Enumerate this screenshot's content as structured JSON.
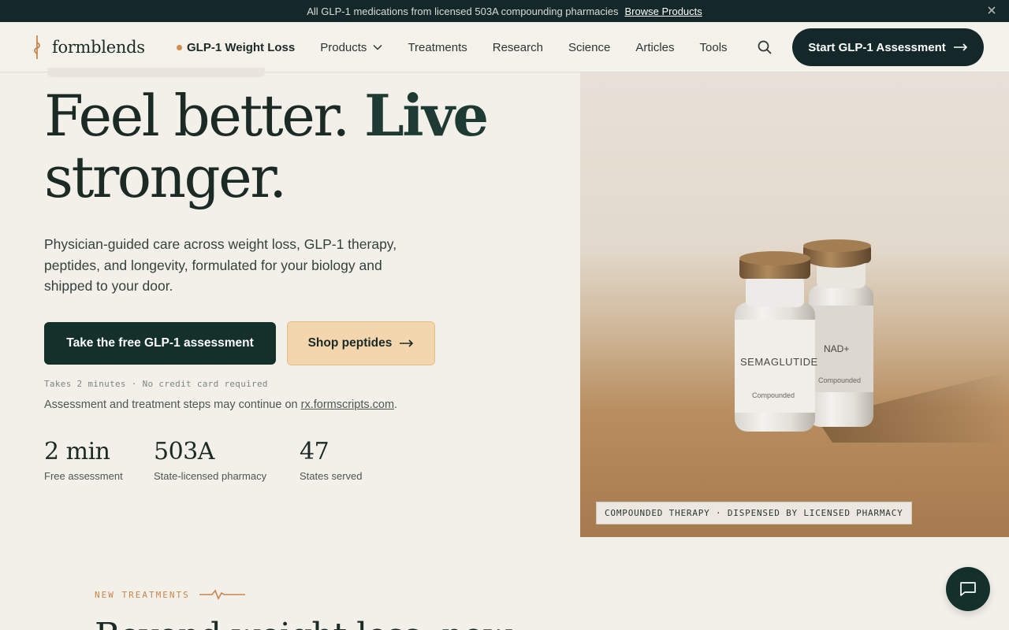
{
  "announcement": {
    "text": "All GLP-1 medications from licensed 503A compounding pharmacies",
    "link": "Browse Products"
  },
  "nav": {
    "logo": "formblends",
    "highlight": "GLP-1 Weight Loss",
    "items": [
      "Products",
      "Treatments",
      "Research",
      "Science",
      "Articles",
      "Tools"
    ],
    "cta": "Start GLP-1 Assessment"
  },
  "hero": {
    "headline_a": "Feel better. ",
    "headline_b": "Live",
    "headline_c": "stronger.",
    "subtitle": "Physician-guided care across weight loss, GLP-1 therapy, peptides, and longevity, formulated for your biology and shipped to your door.",
    "primary_cta": "Take the free GLP-1 assessment",
    "secondary_cta": "Shop peptides",
    "fine_print": "Takes 2 minutes · No credit card required",
    "note_prefix": "Assessment and treatment steps may continue on ",
    "note_link": "rx.formscripts.com",
    "note_suffix": "."
  },
  "stats": [
    {
      "value": "2 min",
      "label": "Free assessment"
    },
    {
      "value": "503A",
      "label": "State-licensed pharmacy"
    },
    {
      "value": "47",
      "label": "States served"
    }
  ],
  "photo": {
    "vial_1_label": "SEMAGLUTIDE",
    "vial_1_sub": "Compounded",
    "vial_2_label": "NAD+",
    "vial_2_sub": "Compounded",
    "caption": "COMPOUNDED THERAPY · DISPENSED BY LICENSED PHARMACY"
  },
  "section": {
    "eyebrow": "NEW TREATMENTS",
    "title": "Beyond weight loss, now"
  },
  "colors": {
    "dark": "#14282a",
    "accent": "#d08e4c",
    "peach": "#f3d6ae",
    "background": "#f3f0ea"
  },
  "icons": [
    "close-icon",
    "logo-mark-icon",
    "chevron-down-icon",
    "search-icon",
    "arrow-right-icon",
    "heartbeat-icon",
    "chat-icon"
  ]
}
